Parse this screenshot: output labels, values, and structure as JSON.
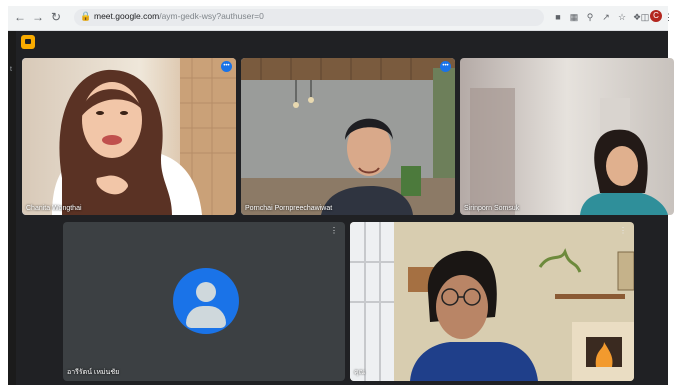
{
  "browser": {
    "url_host": "meet.google.com",
    "url_path": "/aym-gedk-wsy?authuser=0",
    "profile_initial": "C"
  },
  "meet": {
    "side_label": "t",
    "participants": [
      {
        "name": "Chanita Wongthai",
        "speaking": true
      },
      {
        "name": "Pornchai Pornpreechawiwat",
        "speaking": true
      },
      {
        "name": "Sirinporn Somsuk",
        "speaking": false
      },
      {
        "name": "อารีรัตน์ เหม่นชัย",
        "speaking": false
      },
      {
        "name": "คุณ",
        "speaking": false
      }
    ]
  },
  "colors": {
    "meet_bg": "#202124",
    "avatar_blue": "#1a73e8",
    "speaking_ring": "#8ab4f8"
  }
}
